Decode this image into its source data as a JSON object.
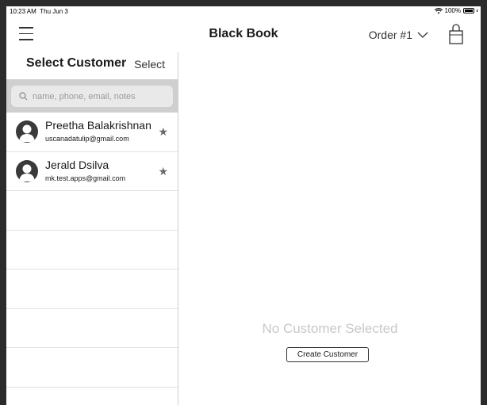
{
  "status_bar": {
    "time": "10:23 AM",
    "date": "Thu Jun 3",
    "battery": "100%"
  },
  "nav": {
    "title": "Black Book",
    "order_label": "Order #1",
    "menu_icon": "hamburger-icon",
    "cart_icon": "shopping-bag-icon"
  },
  "sidebar": {
    "title": "Select Customer",
    "select_label": "Select",
    "search_placeholder": "name, phone, email, notes",
    "customers": [
      {
        "name": "Preetha Balakrishnan",
        "email": "uscanadatulip@gmail.com"
      },
      {
        "name": "Jerald Dsilva",
        "email": "mk.test.apps@gmail.com"
      }
    ]
  },
  "content": {
    "empty_message": "No Customer Selected",
    "create_button": "Create Customer"
  }
}
